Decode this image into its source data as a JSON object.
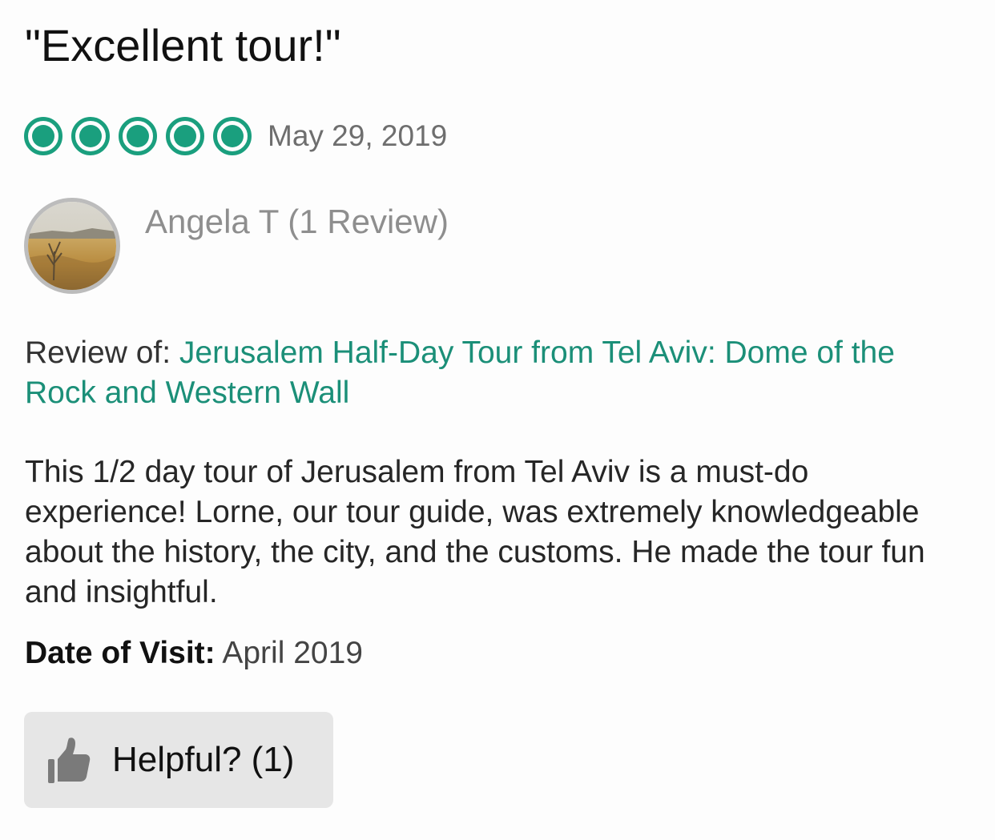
{
  "review": {
    "title": "\"Excellent tour!\"",
    "rating": 5,
    "rating_max": 5,
    "date": "May 29, 2019",
    "reviewer": "Angela T (1 Review)",
    "review_of_label": "Review of:",
    "review_of_link": "Jerusalem Half-Day Tour from Tel Aviv: Dome of the Rock and Western Wall",
    "body": "This 1/2 day tour of Jerusalem from Tel Aviv is a must-do experience! Lorne, our tour guide, was extremely knowledgeable about the history, the city, and the customs. He made the tour fun and insightful.",
    "date_of_visit_label": "Date of Visit:",
    "date_of_visit": "April 2019",
    "helpful_label": "Helpful? (1)"
  },
  "icons": {
    "rating": "bubble-rating-icon",
    "avatar": "avatar-landscape-photo",
    "helpful": "thumbs-up-icon"
  },
  "colors": {
    "accent": "#1a9f7e",
    "link": "#1b8f78",
    "muted": "#8e8e8e",
    "button_bg": "#e6e6e6"
  }
}
